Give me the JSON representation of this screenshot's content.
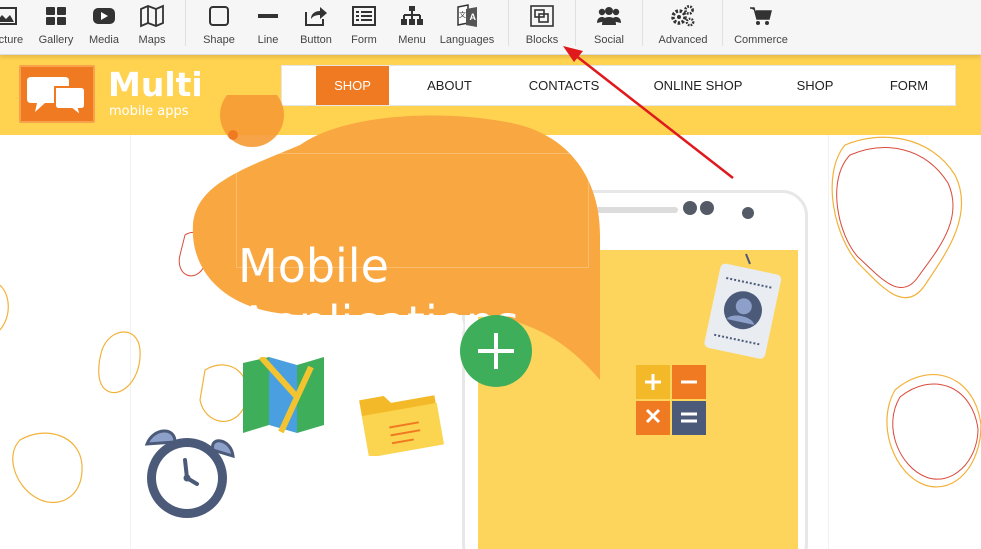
{
  "toolbar": {
    "items": [
      {
        "label": "Picture",
        "icon": "picture-icon"
      },
      {
        "label": "Gallery",
        "icon": "gallery-icon"
      },
      {
        "label": "Media",
        "icon": "media-play-icon"
      },
      {
        "label": "Maps",
        "icon": "map-icon"
      },
      {
        "label": "Shape",
        "icon": "shape-square-icon"
      },
      {
        "label": "Line",
        "icon": "line-icon"
      },
      {
        "label": "Button",
        "icon": "share-button-icon"
      },
      {
        "label": "Form",
        "icon": "form-icon"
      },
      {
        "label": "Menu",
        "icon": "sitemap-icon"
      },
      {
        "label": "Languages",
        "icon": "translate-icon"
      },
      {
        "label": "Blocks",
        "icon": "blocks-icon"
      },
      {
        "label": "Social",
        "icon": "users-icon"
      },
      {
        "label": "Advanced",
        "icon": "gears-icon"
      },
      {
        "label": "Commerce",
        "icon": "cart-icon"
      }
    ]
  },
  "site": {
    "logo": {
      "title": "Multi",
      "subtitle": "mobile apps",
      "icon": "speech-bubbles-icon"
    },
    "nav": [
      "SHOP",
      "ABOUT",
      "CONTACTS",
      "ONLINE SHOP",
      "SHOP",
      "FORM"
    ],
    "hero": {
      "line1": "Mobile",
      "line2": "Applications"
    }
  },
  "colors": {
    "header_yellow": "#ffd24f",
    "brand_orange": "#f07a22",
    "bubble_orange": "#f9a740",
    "plus_green": "#3fae5a",
    "annotation_red": "#e0191c"
  }
}
